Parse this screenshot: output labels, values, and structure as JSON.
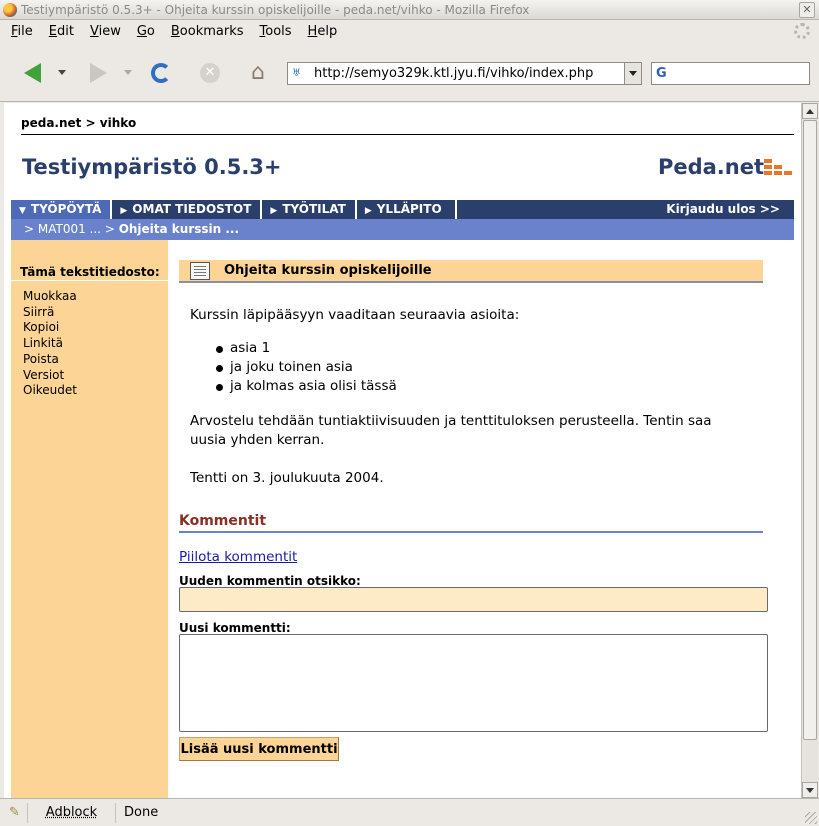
{
  "window": {
    "title": "Testiympäristö 0.5.3+ - Ohjeita kurssin opiskelijoille - peda.net/vihko - Mozilla Firefox",
    "close_label": "✕"
  },
  "menu": [
    "File",
    "Edit",
    "View",
    "Go",
    "Bookmarks",
    "Tools",
    "Help"
  ],
  "toolbar": {
    "url": "http://semyo329k.ktl.jyu.fi/vihko/index.php",
    "search_value": ""
  },
  "site": {
    "breadcrumb": "peda.net > vihko",
    "title": "Testiympäristö 0.5.3+",
    "brand": "Peda.net",
    "brand_color": "#e8762a",
    "tabs": [
      {
        "label": "TYÖPÖYTÄ",
        "arrow": "▼"
      },
      {
        "label": "OMAT TIEDOSTOT",
        "arrow": "▶"
      },
      {
        "label": "TYÖTILAT",
        "arrow": "▶"
      },
      {
        "label": "YLLÄPITO",
        "arrow": "▶"
      }
    ],
    "logout": "Kirjaudu ulos >>",
    "subnav": {
      "prefix": "> MAT001 ... > ",
      "current": "Ohjeita kurssin ..."
    }
  },
  "sidebar": {
    "heading": "Tämä tekstitiedosto:",
    "items": [
      "Muokkaa",
      "Siirrä",
      "Kopioi",
      "Linkitä",
      "Poista",
      "Versiot",
      "Oikeudet"
    ]
  },
  "document": {
    "title": "Ohjeita kurssin opiskelijoille",
    "intro": "Kurssin läpipääsyyn vaaditaan seuraavia asioita:",
    "bullets": [
      "asia 1",
      "ja joku toinen asia",
      "ja kolmas asia olisi tässä"
    ],
    "paragraph2": "Arvostelu tehdään tuntiaktiivisuuden ja tenttituloksen perusteella. Tentin saa uusia yhden kerran.",
    "paragraph3": "Tentti on 3. joulukuuta 2004."
  },
  "comments": {
    "heading": "Kommentit",
    "hide_link": "Piilota kommentit",
    "title_label": "Uuden kommentin otsikko:",
    "title_value": "",
    "body_label": "Uusi kommentti:",
    "body_value": "",
    "submit_label": "Lisää uusi kommentti"
  },
  "statusbar": {
    "addon": "Adblock",
    "status": "Done"
  }
}
